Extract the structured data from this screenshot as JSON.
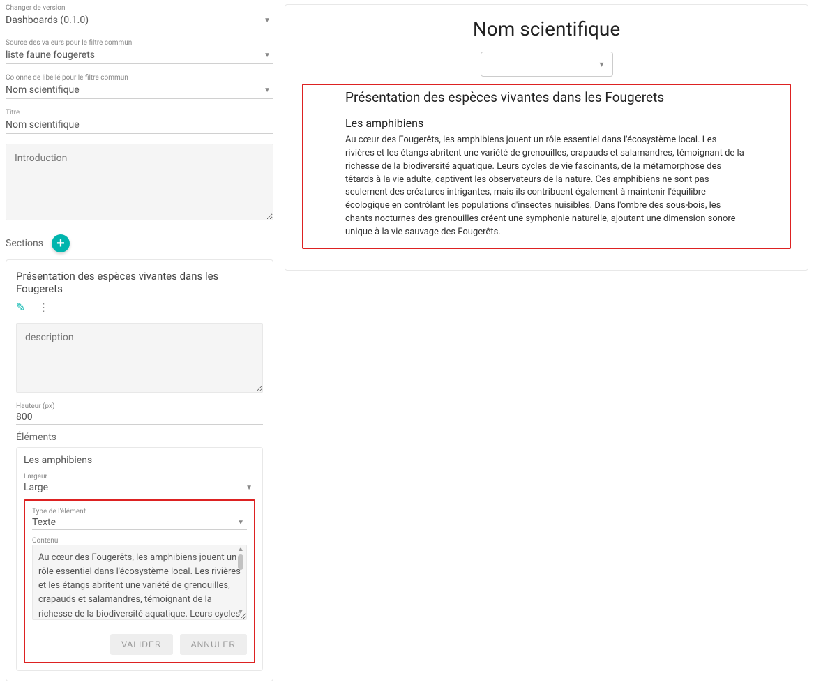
{
  "form": {
    "version": {
      "label": "Changer de version",
      "value": "Dashboards (0.1.0)"
    },
    "source": {
      "label": "Source des valeurs pour le filtre commun",
      "value": "liste faune fougerets"
    },
    "libelle": {
      "label": "Colonne de libellé pour le filtre commun",
      "value": "Nom scientifique"
    },
    "titre": {
      "label": "Titre",
      "value": "Nom scientifique"
    },
    "intro_placeholder": "Introduction",
    "sections_label": "Sections"
  },
  "section": {
    "title": "Présentation des espèces vivantes dans les Fougerets",
    "description_placeholder": "description",
    "hauteur_label": "Hauteur (px)",
    "hauteur_value": "800",
    "elements_label": "Éléments",
    "element_title": "Les amphibiens",
    "largeur_label": "Largeur",
    "largeur_value": "Large",
    "type_label": "Type de l'élément",
    "type_value": "Texte",
    "contenu_label": "Contenu",
    "contenu_value": "Au cœur des Fougerêts, les amphibiens jouent un rôle essentiel dans l'écosystème local. Les rivières et les étangs abritent une variété de grenouilles, crapauds et salamandres, témoignant de la richesse de la biodiversité aquatique. Leurs cycles de vie fascinants, de la métamorphose des têtards à la",
    "valider": "VALIDER",
    "annuler": "ANNULER"
  },
  "preview": {
    "title": "Nom scientifique",
    "h2": "Présentation des espèces vivantes dans les Fougerets",
    "h3": "Les amphibiens",
    "p": "Au cœur des Fougerêts, les amphibiens jouent un rôle essentiel dans l'écosystème local. Les rivières et les étangs abritent une variété de grenouilles, crapauds et salamandres, témoignant de la richesse de la biodiversité aquatique. Leurs cycles de vie fascinants, de la métamorphose des têtards à la vie adulte, captivent les observateurs de la nature. Ces amphibiens ne sont pas seulement des créatures intrigantes, mais ils contribuent également à maintenir l'équilibre écologique en contrôlant les populations d'insectes nuisibles. Dans l'ombre des sous-bois, les chants nocturnes des grenouilles créent une symphonie naturelle, ajoutant une dimension sonore unique à la vie sauvage des Fougerêts."
  }
}
